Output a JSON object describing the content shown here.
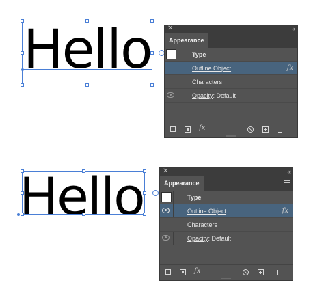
{
  "top": {
    "word": "Hello",
    "panel": {
      "close_glyph": "✕",
      "collapse_glyph": "‹‹",
      "tab_label": "Appearance",
      "menu_icon": "panel-menu-icon",
      "rows": {
        "type_label": "Type",
        "outline_label": "Outline Object",
        "outline_fx": "fx",
        "characters_label": "Characters",
        "opacity_label": "Opacity",
        "opacity_value": ": Default"
      },
      "footer": {
        "fx_label": "fx"
      }
    }
  },
  "bottom": {
    "word": "Hello",
    "panel": {
      "close_glyph": "✕",
      "collapse_glyph": "‹‹",
      "tab_label": "Appearance",
      "menu_icon": "panel-menu-icon",
      "rows": {
        "type_label": "Type",
        "outline_label": "Outline Object",
        "outline_fx": "fx",
        "characters_label": "Characters",
        "opacity_label": "Opacity",
        "opacity_value": ": Default"
      },
      "footer": {
        "fx_label": "fx"
      }
    }
  },
  "colors": {
    "selection_blue": "#4a7fd6",
    "panel_bg": "#535353",
    "panel_header_bg": "#3c3c3c",
    "row_selected": "#48647e"
  }
}
